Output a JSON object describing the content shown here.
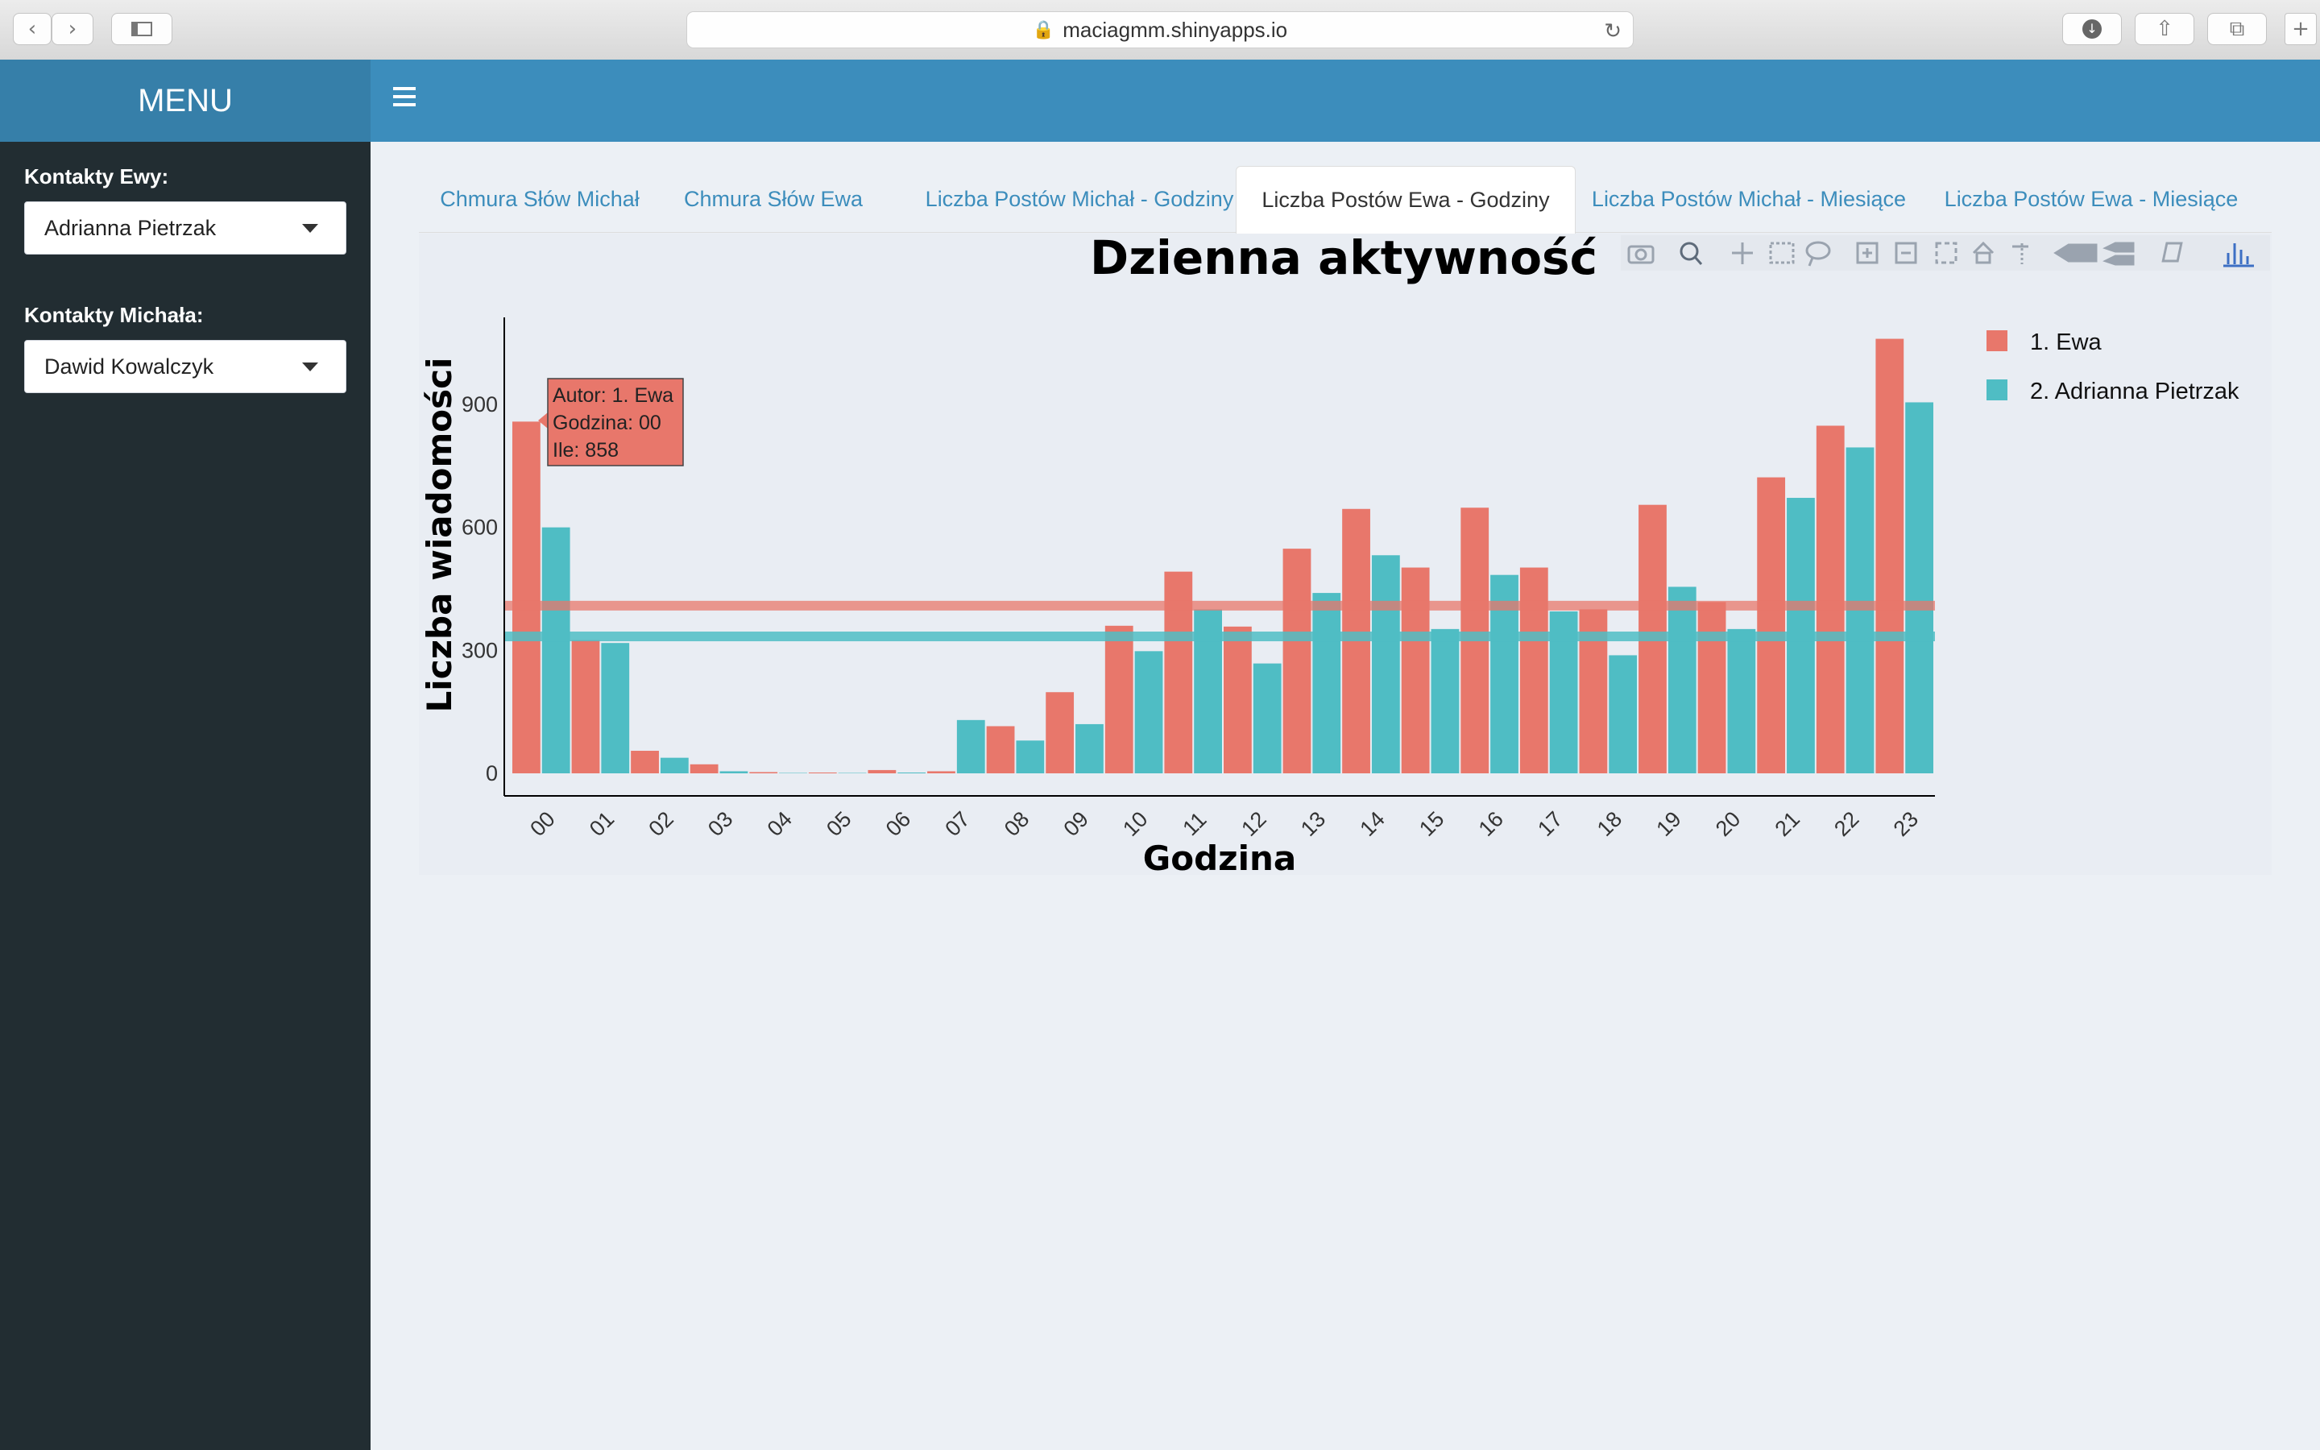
{
  "browser": {
    "url": "maciagmm.shinyapps.io",
    "back_icon": "chevron-left",
    "forward_icon": "chevron-right"
  },
  "sidebar": {
    "title": "MENU",
    "contacts_ewa_label": "Kontakty Ewy:",
    "contacts_ewa_value": "Adrianna Pietrzak",
    "contacts_michal_label": "Kontakty Michała:",
    "contacts_michal_value": "Dawid Kowalczyk"
  },
  "tabs": [
    {
      "label": "Chmura Słów Michał"
    },
    {
      "label": "Chmura Słów Ewa"
    },
    {
      "label": "Liczba Postów Michał - Godziny"
    },
    {
      "label": "Liczba Postów Ewa - Godziny",
      "active": true
    },
    {
      "label": "Liczba Postów Michał - Miesiące"
    },
    {
      "label": "Liczba Postów Ewa - Miesiące"
    }
  ],
  "tooltip": {
    "line1": "Autor: 1. Ewa",
    "line2": "Godzina: 00",
    "line3": "Ile: 858"
  },
  "colors": {
    "ewa": "#e8776b",
    "partner": "#4fbdc4",
    "sidebar": "#222d32",
    "header": "#3c8dbc"
  },
  "chart_data": {
    "type": "bar",
    "title": "Dzienna aktywność",
    "xlabel": "Godzina",
    "ylabel": "Liczba wiadomości",
    "ylim": [
      0,
      1140
    ],
    "yticks": [
      0,
      300,
      600,
      900
    ],
    "categories": [
      "00",
      "01",
      "02",
      "03",
      "04",
      "05",
      "06",
      "07",
      "08",
      "09",
      "10",
      "11",
      "12",
      "13",
      "14",
      "15",
      "16",
      "17",
      "18",
      "19",
      "20",
      "21",
      "22",
      "23"
    ],
    "series": [
      {
        "name": "1. Ewa",
        "mean": 409,
        "values": [
          858,
          325,
          55,
          22,
          3,
          2,
          8,
          5,
          115,
          198,
          360,
          492,
          358,
          548,
          645,
          502,
          648,
          502,
          400,
          655,
          418,
          722,
          848,
          1060
        ]
      },
      {
        "name": "2. Adrianna Pietrzak",
        "mean": 334,
        "values": [
          600,
          318,
          38,
          5,
          1,
          1,
          2,
          130,
          80,
          120,
          298,
          400,
          268,
          440,
          532,
          352,
          484,
          395,
          288,
          455,
          352,
          672,
          795,
          905
        ]
      }
    ],
    "legend_position": "right"
  }
}
